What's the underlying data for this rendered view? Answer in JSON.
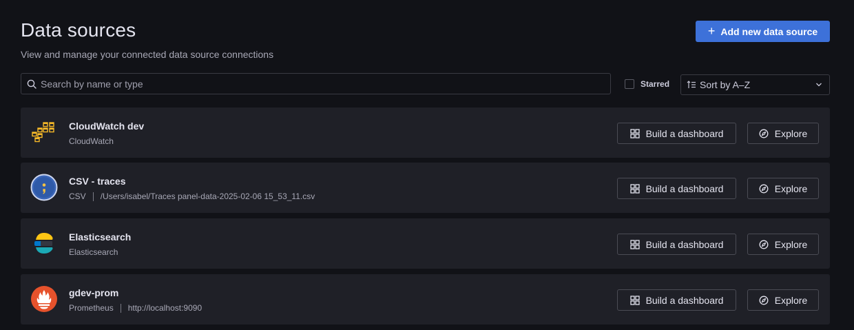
{
  "header": {
    "title": "Data sources",
    "subtitle": "View and manage your connected data source connections",
    "add_label": "Add new data source"
  },
  "search": {
    "placeholder": "Search by name or type",
    "value": ""
  },
  "filter": {
    "starred_label": "Starred",
    "starred_checked": false
  },
  "sort": {
    "label": "Sort by A–Z"
  },
  "actions": {
    "build_label": "Build a dashboard",
    "explore_label": "Explore"
  },
  "datasources": [
    {
      "name": "CloudWatch dev",
      "type": "CloudWatch",
      "url": "",
      "logo": "cloudwatch-logo"
    },
    {
      "name": "CSV - traces",
      "type": "CSV",
      "url": "/Users/isabel/Traces panel-data-2025-02-06 15_53_11.csv",
      "logo": "csv-logo"
    },
    {
      "name": "Elasticsearch",
      "type": "Elasticsearch",
      "url": "",
      "logo": "elasticsearch-logo"
    },
    {
      "name": "gdev-prom",
      "type": "Prometheus",
      "url": "http://localhost:9090",
      "logo": "prometheus-logo"
    }
  ],
  "colors": {
    "primary": "#3d71d9",
    "background": "#111217",
    "card": "#1f2027",
    "cloudwatch": "#f7b928",
    "elastic_yellow": "#fec514",
    "elastic_teal": "#1ba9b5",
    "prometheus": "#e6522c",
    "csv_blue": "#3b66b8"
  }
}
